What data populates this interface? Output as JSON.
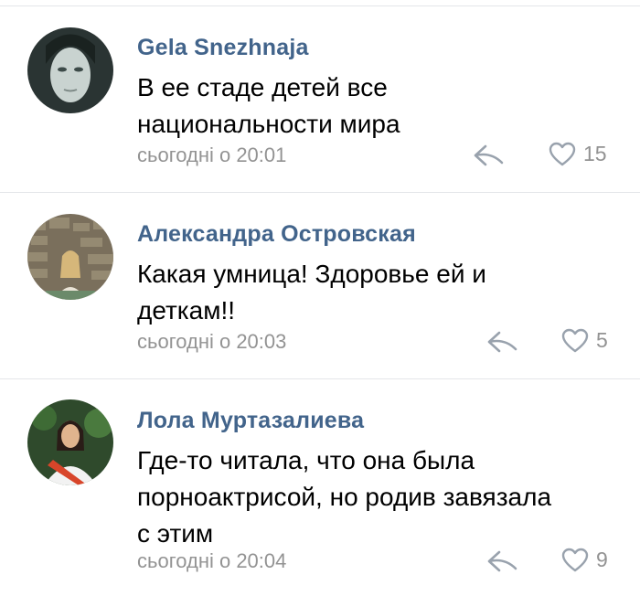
{
  "comments": [
    {
      "author": "Gela Snezhnaja",
      "lines": [
        "В ее стаде детей все",
        "национальности мира"
      ],
      "time": "сьогодні о 20:01",
      "likes": "15",
      "avatar_icon": "avatar-woman-pale-face"
    },
    {
      "author": "Александра Островская",
      "lines": [
        "Какая умница! Здоровье ей и",
        "деткам!!"
      ],
      "time": "сьогодні о 20:03",
      "likes": "5",
      "avatar_icon": "avatar-woman-stone-wall"
    },
    {
      "author": "Лола Муртазалиева",
      "lines": [
        "Где-то читала, что она была",
        "порноактрисой, но родив завязала",
        "с этим"
      ],
      "time": "сьогодні о 20:04",
      "likes": "9",
      "avatar_icon": "avatar-girl-red-sash"
    }
  ],
  "colors": {
    "author": "#42648b",
    "meta": "#939393",
    "divider": "#e4e6e9",
    "icon": "#99a2ad"
  },
  "icons": {
    "reply": "reply-arrow-icon",
    "like": "heart-outline-icon"
  }
}
